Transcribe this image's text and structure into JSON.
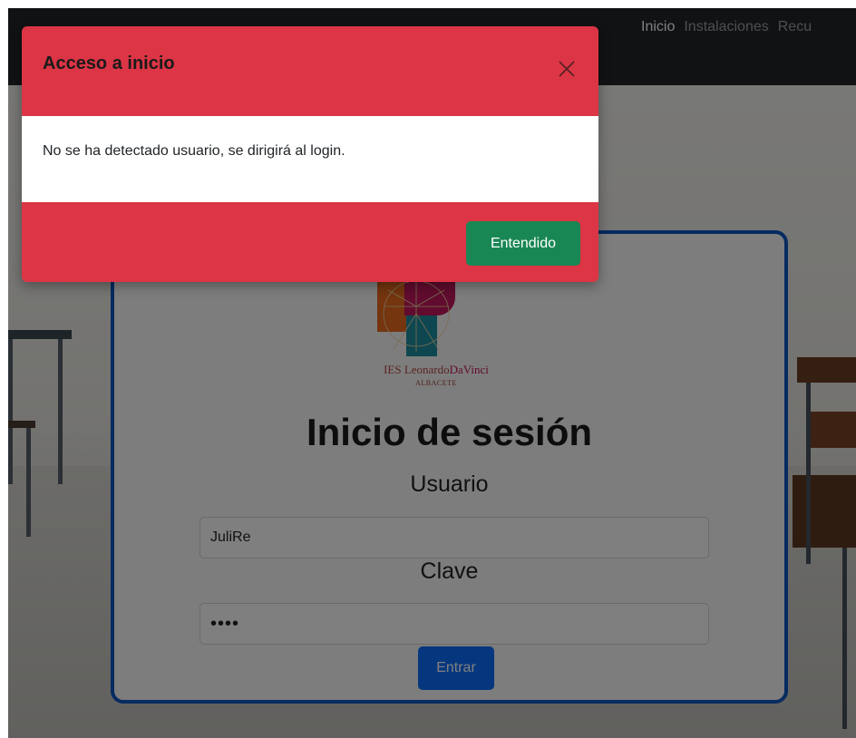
{
  "navbar": {
    "items": [
      {
        "label": "Inicio",
        "active": true
      },
      {
        "label": "Instalaciones",
        "active": false
      },
      {
        "label": "Recu",
        "active": false
      }
    ]
  },
  "login": {
    "logo": {
      "text_ies": "IES ",
      "text_leonardo": "Leonardo",
      "text_davinci": "DaVinci",
      "text_city": "ALBACETE"
    },
    "title": "Inicio de sesión",
    "user_label": "Usuario",
    "user_value": "JuliRe",
    "password_label": "Clave",
    "password_value": "••••",
    "submit_label": "Entrar"
  },
  "modal": {
    "title": "Acceso a inicio",
    "message": "No se ha detectado usuario, se dirigirá al login.",
    "confirm_label": "Entendido",
    "close_icon": "close-icon"
  },
  "colors": {
    "navbar": "#212529",
    "modal_danger": "#dc3545",
    "confirm_success": "#198754",
    "primary": "#0d6efd",
    "card_border": "#0d57c2"
  }
}
